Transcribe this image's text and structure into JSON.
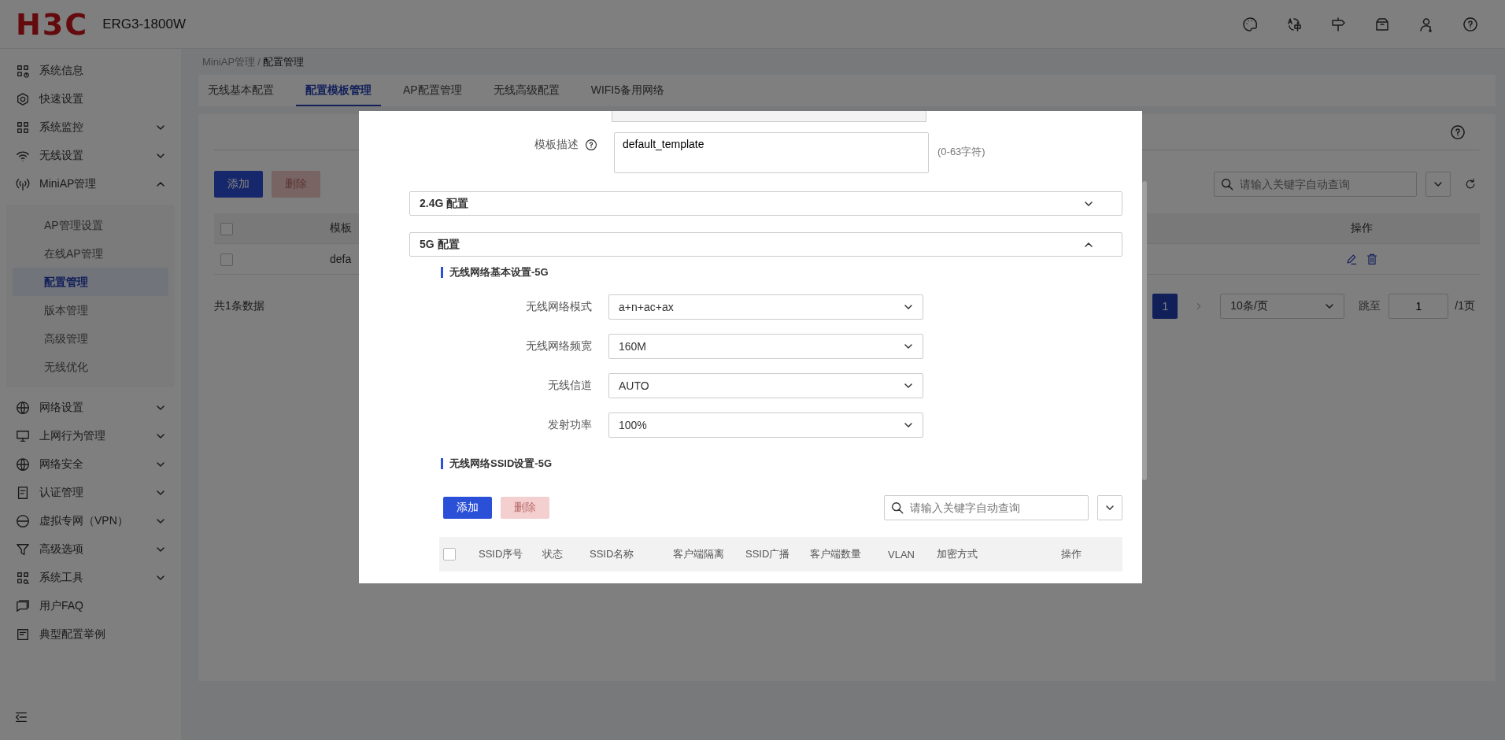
{
  "header": {
    "brand": "H3C",
    "model": "ERG3-1800W"
  },
  "sidebar": {
    "items": [
      {
        "label": "系统信息",
        "kind": "link"
      },
      {
        "label": "快速设置",
        "kind": "link"
      },
      {
        "label": "系统监控",
        "kind": "group",
        "expanded": false
      },
      {
        "label": "无线设置",
        "kind": "group",
        "expanded": false
      },
      {
        "label": "MiniAP管理",
        "kind": "group",
        "expanded": true,
        "children": [
          {
            "label": "AP管理设置",
            "selected": false
          },
          {
            "label": "在线AP管理",
            "selected": false
          },
          {
            "label": "配置管理",
            "selected": true
          },
          {
            "label": "版本管理",
            "selected": false
          },
          {
            "label": "高级管理",
            "selected": false
          },
          {
            "label": "无线优化",
            "selected": false
          }
        ]
      },
      {
        "label": "网络设置",
        "kind": "group",
        "expanded": false
      },
      {
        "label": "上网行为管理",
        "kind": "group",
        "expanded": false
      },
      {
        "label": "网络安全",
        "kind": "group",
        "expanded": false
      },
      {
        "label": "认证管理",
        "kind": "group",
        "expanded": false
      },
      {
        "label": "虚拟专网（VPN）",
        "kind": "group",
        "expanded": false
      },
      {
        "label": "高级选项",
        "kind": "group",
        "expanded": false
      },
      {
        "label": "系统工具",
        "kind": "group",
        "expanded": false
      },
      {
        "label": "用户FAQ",
        "kind": "link"
      },
      {
        "label": "典型配置举例",
        "kind": "link"
      }
    ]
  },
  "breadcrumb": {
    "separator": "/",
    "items": [
      "MiniAP管理",
      "配置管理"
    ]
  },
  "tabs": [
    {
      "label": "无线基本配置",
      "selected": false
    },
    {
      "label": "配置模板管理",
      "selected": true
    },
    {
      "label": "AP配置管理",
      "selected": false
    },
    {
      "label": "无线高级配置",
      "selected": false
    },
    {
      "label": "WIFI5备用网络",
      "selected": false
    }
  ],
  "toolbar": {
    "buttons": [
      {
        "label": "添加",
        "disabled": false
      },
      {
        "label": "删除",
        "disabled": true
      }
    ],
    "search": {
      "placeholder": "请输入关键字自动查询"
    }
  },
  "table": {
    "select_all": false,
    "columns": [
      "模板",
      "操作"
    ],
    "rows": [
      {
        "checked": false,
        "cells": [
          "defa"
        ]
      }
    ]
  },
  "footer": {
    "total": "共1条数据",
    "pages": [
      {
        "label": "1",
        "selected": true
      }
    ],
    "page_size": "10条/页",
    "jump_label": "跳至",
    "jump_value": "1",
    "page_count": "/1页"
  },
  "dialog": {
    "description": {
      "label": "模板描述",
      "value": "default_template",
      "hint": "(0-63字符)"
    },
    "sections": [
      {
        "title": "2.4G 配置",
        "expanded": false
      },
      {
        "title": "5G 配置",
        "expanded": true
      }
    ],
    "basic": {
      "title": "无线网络基本设置-5G",
      "fields": [
        {
          "label": "无线网络模式",
          "value": "a+n+ac+ax"
        },
        {
          "label": "无线网络频宽",
          "value": "160M"
        },
        {
          "label": "无线信道",
          "value": "AUTO"
        },
        {
          "label": "发射功率",
          "value": "100%"
        }
      ]
    },
    "ssid": {
      "title": "无线网络SSID设置-5G",
      "buttons": [
        {
          "label": "添加",
          "disabled": false
        },
        {
          "label": "删除",
          "disabled": true
        }
      ],
      "search": {
        "placeholder": "请输入关键字自动查询"
      },
      "select_all": false,
      "columns": [
        "SSID序号",
        "状态",
        "SSID名称",
        "客户端隔离",
        "SSID广播",
        "客户端数量",
        "VLAN",
        "加密方式",
        "操作"
      ]
    }
  }
}
